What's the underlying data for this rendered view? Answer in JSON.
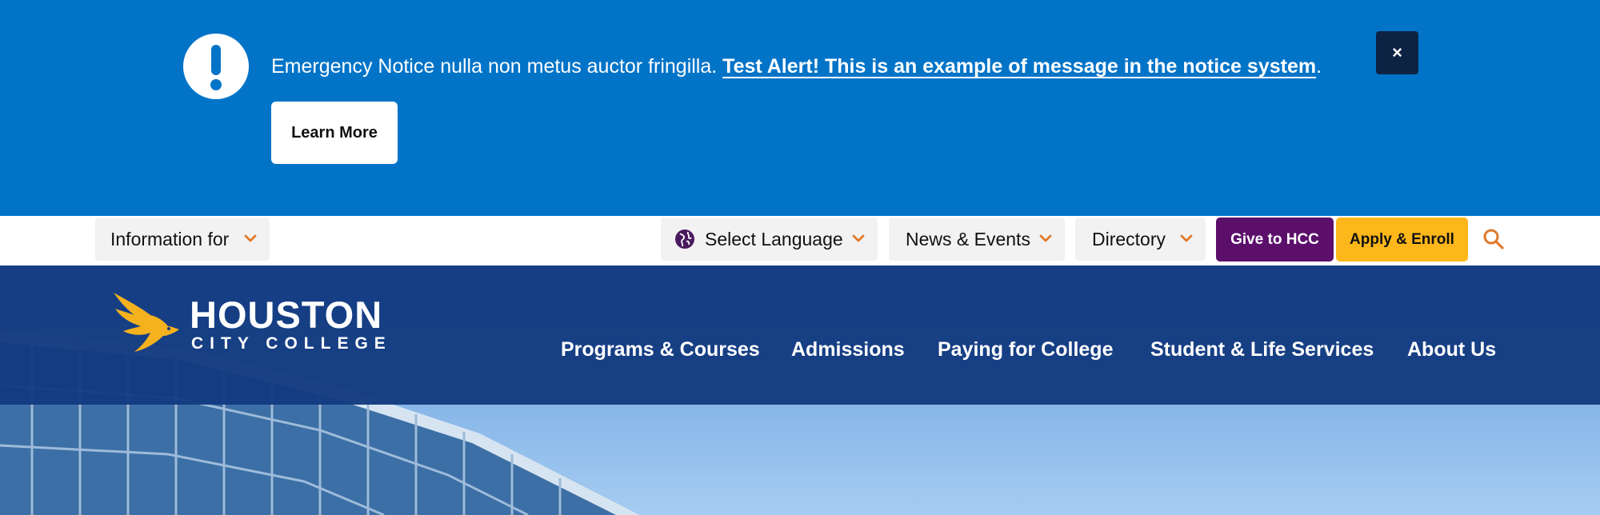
{
  "alert": {
    "message": "Emergency Notice nulla non metus auctor fringilla. ",
    "link_text": "Test Alert! This is an example of message in the notice system",
    "trailing": ".",
    "learn_more_label": "Learn More",
    "close_label": "×",
    "icon": "exclamation-icon"
  },
  "utility_bar": {
    "information_for": "Information for",
    "select_language": "Select Language",
    "news_events": "News & Events",
    "directory": "Directory",
    "give_label": "Give to HCC",
    "apply_label": "Apply & Enroll",
    "search_icon": "search-icon"
  },
  "logo": {
    "main": "HOUSTON",
    "sub": "CITY COLLEGE"
  },
  "main_nav": {
    "items": [
      "Programs & Courses",
      "Admissions",
      "Paying for College",
      "Student & Life Services",
      "About Us"
    ]
  },
  "colors": {
    "alert_bg": "#0274c8",
    "nav_bg": "#133a80",
    "give_bg": "#5b0f6b",
    "apply_bg": "#fdb71a",
    "chevron": "#e07a2c",
    "logo_bird": "#f5b21e"
  }
}
